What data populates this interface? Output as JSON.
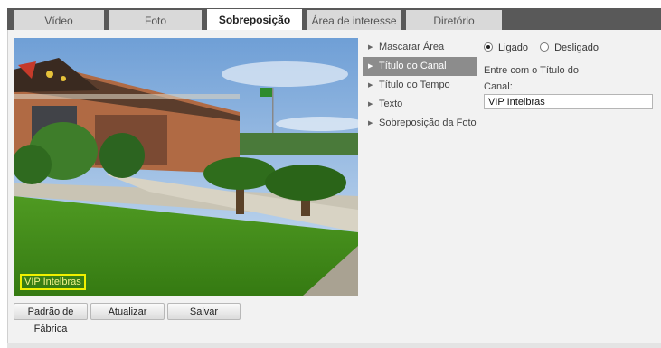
{
  "tabs": [
    {
      "label": "Vídeo"
    },
    {
      "label": "Foto"
    },
    {
      "label": "Sobreposição"
    },
    {
      "label": "Área de interesse"
    },
    {
      "label": "Diretório"
    }
  ],
  "active_tab": "Sobreposição",
  "preview": {
    "overlay_text": "VIP Intelbras"
  },
  "buttons": {
    "factory": "Padrão de Fábrica",
    "refresh": "Atualizar",
    "save": "Salvar"
  },
  "menu": {
    "items": [
      {
        "label": "Mascarar Área"
      },
      {
        "label": "Título do Canal"
      },
      {
        "label": "Título do Tempo"
      },
      {
        "label": "Texto"
      },
      {
        "label": "Sobreposição da Foto"
      }
    ],
    "active": "Título do Canal"
  },
  "settings": {
    "on_label": "Ligado",
    "off_label": "Desligado",
    "selected": "Ligado",
    "prompt": "Entre com o Título do Canal:",
    "title_value": "VIP Intelbras"
  },
  "colors": {
    "tab_strip": "#595959",
    "active_menu": "#8c8c8c",
    "overlay_box": "#f0f000"
  }
}
